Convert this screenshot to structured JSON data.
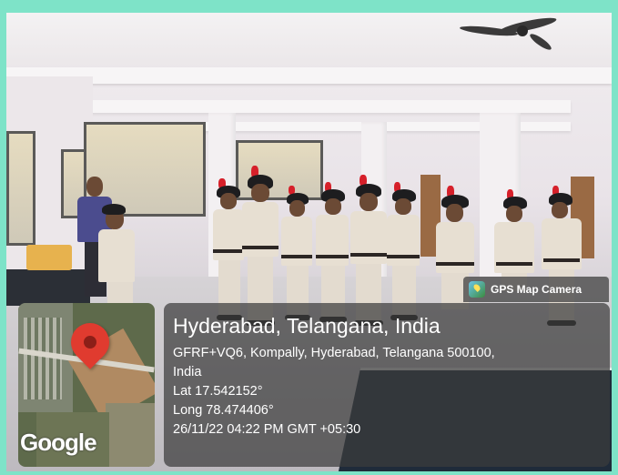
{
  "gps_camera": {
    "badge_label": "GPS Map Camera",
    "icon": "gps-map-camera-icon"
  },
  "map": {
    "provider_label": "Google",
    "pin_color": "#e03b2f"
  },
  "location": {
    "title": "Hyderabad, Telangana, India",
    "address_line1": "GFRF+VQ6, Kompally, Hyderabad, Telangana 500100,",
    "address_line2": "India",
    "latitude": "Lat 17.542152°",
    "longitude": "Long 78.474406°",
    "timestamp": "26/11/22 04:22 PM GMT +05:30"
  },
  "colors": {
    "frame_border": "#7ee3c8",
    "overlay_bg": "rgba(60,60,60,0.72)",
    "plume_red": "#d6202a"
  }
}
